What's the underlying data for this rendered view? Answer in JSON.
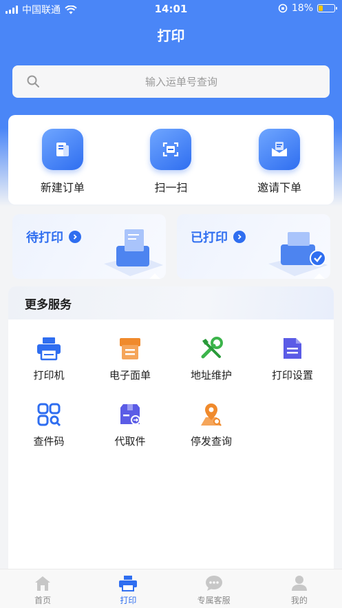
{
  "status_bar": {
    "carrier": "中国联通",
    "time": "14:01",
    "battery": "18%"
  },
  "header": {
    "title": "打印"
  },
  "search": {
    "placeholder": "输入运单号查询"
  },
  "actions": [
    {
      "label": "新建订单",
      "icon": "new-order-icon"
    },
    {
      "label": "扫一扫",
      "icon": "scan-icon"
    },
    {
      "label": "邀请下单",
      "icon": "invite-order-icon"
    }
  ],
  "print_cards": [
    {
      "label": "待打印",
      "icon": "pending-print-icon"
    },
    {
      "label": "已打印",
      "icon": "printed-icon"
    }
  ],
  "services": {
    "title": "更多服务",
    "items": [
      {
        "label": "打印机",
        "icon": "printer-icon",
        "color": "#2f6ef0"
      },
      {
        "label": "电子面单",
        "icon": "e-waybill-icon",
        "color": "#f08a2c"
      },
      {
        "label": "地址维护",
        "icon": "tools-icon",
        "color": "#3cb44b"
      },
      {
        "label": "打印设置",
        "icon": "document-icon",
        "color": "#5b5ce6"
      },
      {
        "label": "查件码",
        "icon": "query-code-icon",
        "color": "#2f6ef0"
      },
      {
        "label": "代取件",
        "icon": "pickup-box-icon",
        "color": "#5b5ce6"
      },
      {
        "label": "停发查询",
        "icon": "location-search-icon",
        "color": "#f08a2c"
      }
    ]
  },
  "tabbar": {
    "active": "打印",
    "items": [
      {
        "label": "首页",
        "icon": "home-icon"
      },
      {
        "label": "打印",
        "icon": "printer-icon"
      },
      {
        "label": "专属客服",
        "icon": "chat-icon"
      },
      {
        "label": "我的",
        "icon": "user-icon"
      }
    ]
  }
}
